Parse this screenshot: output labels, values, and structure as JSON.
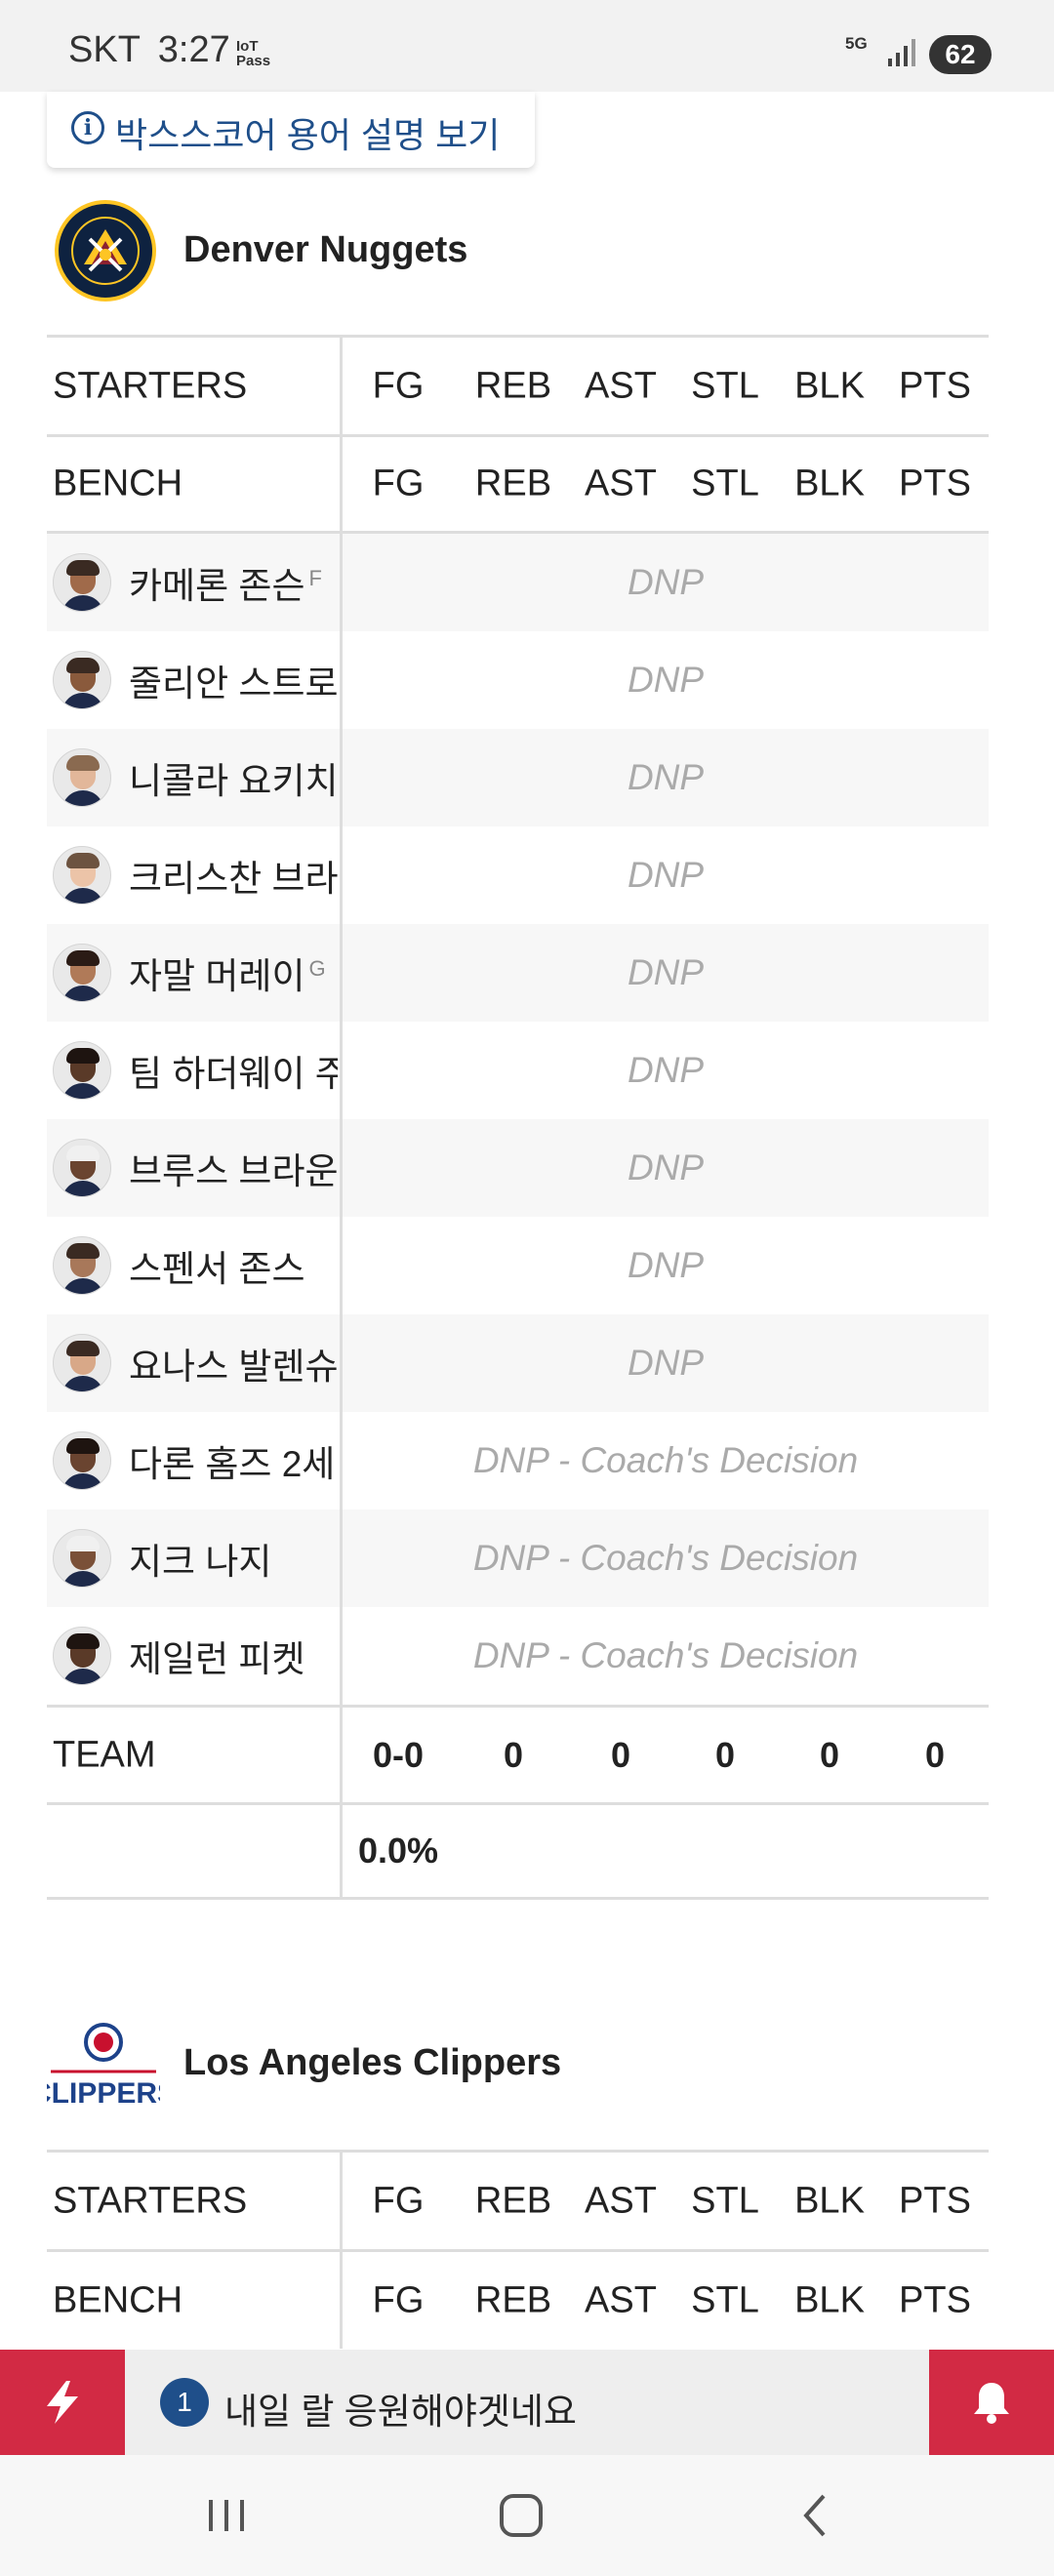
{
  "status_bar": {
    "carrier": "SKT",
    "time": "3:27",
    "iot_top": "IoT",
    "iot_bottom": "Pass",
    "network": "5G",
    "battery": "62"
  },
  "help_link": {
    "icon": "info-icon",
    "label": "박스스코어 용어 설명 보기"
  },
  "teams": [
    {
      "name": "Denver Nuggets",
      "logo": "denver-nuggets-logo",
      "colors": {
        "navy": "#0e2240",
        "gold": "#fec524",
        "red": "#8b2131"
      },
      "starters_label": "STARTERS",
      "bench_label": "BENCH",
      "columns": [
        "FG",
        "REB",
        "AST",
        "STL",
        "BLK",
        "PTS"
      ],
      "players": [
        {
          "name": "카메론 존슨",
          "pos": "F",
          "status": "DNP"
        },
        {
          "name": "줄리안 스트로더",
          "pos": "",
          "status": "DNP"
        },
        {
          "name": "니콜라 요키치",
          "pos": "",
          "status": "DNP"
        },
        {
          "name": "크리스찬 브라운",
          "pos": "",
          "status": "DNP"
        },
        {
          "name": "자말 머레이",
          "pos": "G",
          "status": "DNP"
        },
        {
          "name": "팀 하더웨이 주니어",
          "pos": "",
          "status": "DNP"
        },
        {
          "name": "브루스 브라운",
          "pos": "",
          "status": "DNP"
        },
        {
          "name": "스펜서 존스",
          "pos": "",
          "status": "DNP"
        },
        {
          "name": "요나스 발렌슈나스",
          "pos": "",
          "status": "DNP"
        },
        {
          "name": "다론 홈즈 2세",
          "pos": "",
          "status": "DNP - Coach's Decision"
        },
        {
          "name": "지크 나지",
          "pos": "",
          "status": "DNP - Coach's Decision"
        },
        {
          "name": "제일런 피켓",
          "pos": "",
          "status": "DNP - Coach's Decision"
        }
      ],
      "team_row": {
        "label": "TEAM",
        "values": [
          "0-0",
          "0",
          "0",
          "0",
          "0",
          "0"
        ],
        "fg_pct": "0.0%"
      }
    },
    {
      "name": "Los Angeles Clippers",
      "logo": "la-clippers-logo",
      "colors": {
        "blue": "#1d428a",
        "red": "#c8102e"
      },
      "logo_text": "CLIPPERS",
      "starters_label": "STARTERS",
      "bench_label": "BENCH",
      "columns": [
        "FG",
        "REB",
        "AST",
        "STL",
        "BLK",
        "PTS"
      ]
    }
  ],
  "notification": {
    "count": "1",
    "text": "내일 랄 응원해야겟네요",
    "accent": "#d22a44"
  },
  "nav": {
    "recents": "recents-icon",
    "home": "home-icon",
    "back": "back-icon"
  }
}
